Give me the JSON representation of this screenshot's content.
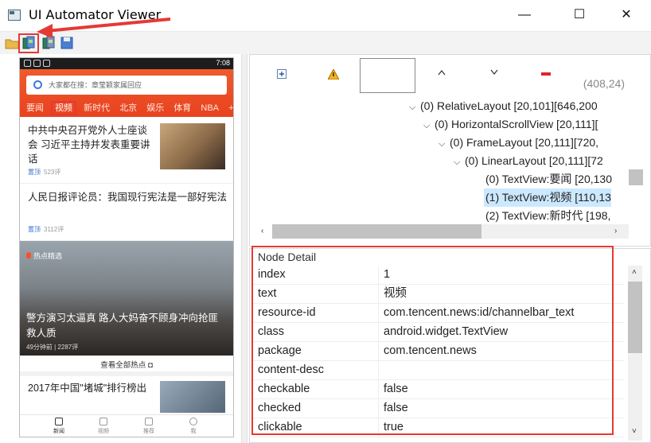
{
  "window": {
    "title": "UI Automator Viewer",
    "minimize": "—",
    "maximize": "☐",
    "close": "✕"
  },
  "toolbar": {
    "items": [
      "open-icon",
      "device-screenshot-icon",
      "device-screenshot-compressed-icon",
      "save-icon"
    ]
  },
  "phone": {
    "status_time": "7:08",
    "search_placeholder": "大家都在搜：章莹颖家属回应",
    "tabs": [
      "要闻",
      "视频",
      "新时代",
      "北京",
      "娱乐",
      "体育",
      "NBA",
      "+"
    ],
    "selected_tab": "视频",
    "news": [
      {
        "title": "中共中央召开党外人士座谈会 习近平主持并发表重要讲话",
        "tag": "置顶",
        "comments": "523评"
      },
      {
        "title": "人民日报评论员：我国现行宪法是一部好宪法",
        "tag": "置顶",
        "comments": "3112评"
      }
    ],
    "featured": {
      "label": "热点精选",
      "title": "警方演习太逼真 路人大妈奋不顾身冲向抢匪救人质",
      "meta": "49分钟前 | 2287评"
    },
    "see_all": "查看全部热点",
    "partial_news": "2017年中国\"堵城\"排行榜出",
    "bottom_nav": [
      "新闻",
      "视频",
      "推荐",
      "我"
    ]
  },
  "tree_toolbar": {
    "coord": "(408,24)"
  },
  "tree": {
    "nodes": [
      {
        "label": "(0) RelativeLayout [20,101][646,200"
      },
      {
        "label": "(0) HorizontalScrollView [20,111]["
      },
      {
        "label": "(0) FrameLayout [20,111][720,"
      },
      {
        "label": "(0) LinearLayout [20,111][72"
      },
      {
        "label": "(0) TextView:要闻 [20,130"
      },
      {
        "label": "(1) TextView:视频 [110,13"
      },
      {
        "label": "(2) TextView:新时代 [198,"
      }
    ]
  },
  "detail": {
    "header": "Node Detail",
    "rows": [
      {
        "key": "index",
        "value": "1"
      },
      {
        "key": "text",
        "value": "视频"
      },
      {
        "key": "resource-id",
        "value": "com.tencent.news:id/channelbar_text"
      },
      {
        "key": "class",
        "value": "android.widget.TextView"
      },
      {
        "key": "package",
        "value": "com.tencent.news"
      },
      {
        "key": "content-desc",
        "value": ""
      },
      {
        "key": "checkable",
        "value": "false"
      },
      {
        "key": "checked",
        "value": "false"
      },
      {
        "key": "clickable",
        "value": "true"
      }
    ]
  },
  "colors": {
    "accent_red": "#e53935",
    "app_header": "#e8421f",
    "tree_selection": "#cce8ff"
  }
}
